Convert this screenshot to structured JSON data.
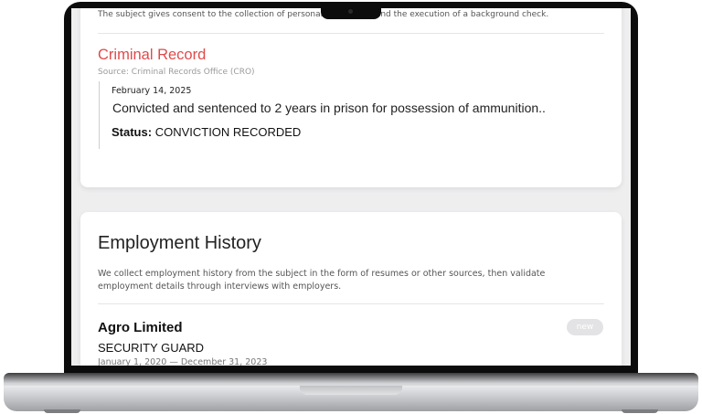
{
  "background_check": {
    "consent_text": "The subject gives consent to the collection of personal information and the execution of a background check.",
    "criminal_record": {
      "title": "Criminal Record",
      "source": "Source: Criminal Records Office (CRO)",
      "entries": [
        {
          "date": "February 14, 2025",
          "description": "Convicted and sentenced to 2 years in prison for possession of ammunition..",
          "status_label": "Status:",
          "status_value": "CONVICTION RECORDED"
        }
      ]
    },
    "employment_history": {
      "title": "Employment History",
      "description": "We collect employment history from the subject in the form of resumes or other sources, then validate employment details through interviews with employers.",
      "entries": [
        {
          "company": "Agro Limited",
          "badge": "new",
          "role": "SECURITY GUARD",
          "dates": "January 1, 2020 — December 31, 2023"
        }
      ]
    }
  },
  "colors": {
    "criminal_title": "#e04a4a",
    "screen_bg": "#eeeeef",
    "bezel": "#0c0c0d"
  }
}
